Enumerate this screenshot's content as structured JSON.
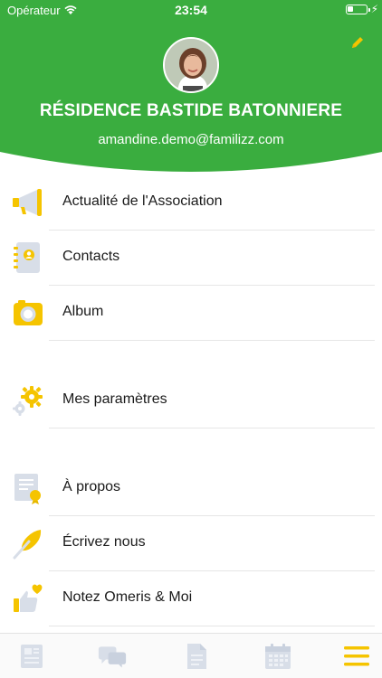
{
  "status_bar": {
    "carrier": "Opérateur",
    "time": "23:54"
  },
  "header": {
    "title": "RÉSIDENCE BASTIDE BATONNIERE",
    "email": "amandine.demo@familizz.com",
    "background_color": "#3aad3f"
  },
  "menu": [
    {
      "label": "Actualité de l'Association",
      "icon": "megaphone-icon"
    },
    {
      "label": "Contacts",
      "icon": "contacts-book-icon"
    },
    {
      "label": "Album",
      "icon": "camera-icon"
    },
    {
      "label": "Mes paramètres",
      "icon": "gears-icon"
    },
    {
      "label": "À propos",
      "icon": "certificate-icon"
    },
    {
      "label": "Écrivez nous",
      "icon": "feather-pen-icon"
    },
    {
      "label": "Notez Omeris & Moi",
      "icon": "thumbs-up-heart-icon"
    }
  ],
  "tabbar": {
    "tabs": [
      "news-tab",
      "messages-tab",
      "documents-tab",
      "calendar-tab",
      "menu-tab"
    ],
    "active": "menu-tab",
    "accent_color": "#f5c400"
  }
}
